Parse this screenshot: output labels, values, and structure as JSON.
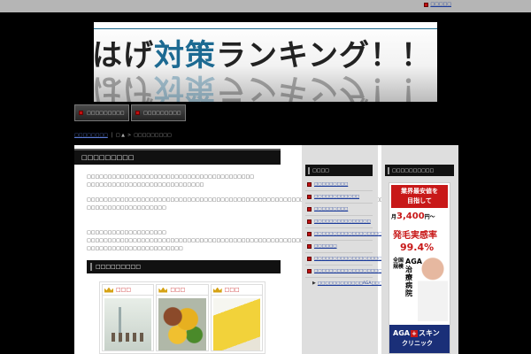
{
  "topbar": {
    "link": "□□□□□"
  },
  "banner": {
    "text_1": "はげ",
    "text_2": "対策",
    "text_3": "ランキング！！"
  },
  "nav": [
    {
      "label": "□□□□□□□□□"
    },
    {
      "label": "□□□□□□□□□"
    }
  ],
  "breadcrumb": {
    "home": "□□□□□□□□",
    "separator_1": "│",
    "extra": "□ ▲",
    "separator_2": ">",
    "current": "□□□□□□□□□"
  },
  "main": {
    "title": "□□□□□□□□□",
    "paragraphs": [
      "□□□□□□□□□□□□□□□□□□□□□□□□□□□□□□□□□□□□□□□□ □□□□□□□□□□□□□□□□□□□□□□□□□□□□",
      "□□□□□□□□□□□□□□□□□□□□□□□□□□□□□□□□□□□□□□□□□□□□□□□□□□□□□□□□□□□□□□□□□□□□□□□□□ □□□□□□□□□□□□□□□□□□□",
      "□□□□□□□□□□□□□□□□□□□",
      "□□□□□□□□□□□□□□□□□□□□□□□□□□□□□□□□□□□□□□□□□□□□□□□□□□□□□□□□□ □□□□□□□□□□□□□□□□□□□□□□□"
    ],
    "ranking_heading": "□□□□□□□□□",
    "ranks": [
      {
        "label": "□□□"
      },
      {
        "label": "□□□"
      },
      {
        "label": "□□□"
      }
    ]
  },
  "sidebar_1": {
    "heading": "□□□□",
    "items": [
      "□□□□□□□□□",
      "□□□□□□□□□□□□",
      "□□□□□□□□□",
      "□□□□□□□□□□□□□□□",
      "□□□□□□□□□□□□□□□□□□□□□□□□□□□",
      "□□□□□□",
      "□□□□□□□□□□□□□□□□□□□□□□□",
      "□□□□□□□□□□□□□□□□□□□□□□"
    ],
    "sub_items": [
      {
        "arrow": "▶",
        "text": "□□□□□□□□□□□□AGA□□□□□□□□□□□□"
      }
    ]
  },
  "sidebar_2": {
    "heading": "□□□□□□□□□□",
    "ad": {
      "top_line_1": "業界最安値を",
      "top_line_2": "目指して",
      "price_prefix": "月",
      "price": "3,400",
      "price_suffix": "円〜",
      "line": "発毛実感率",
      "percent": "99.4%",
      "nation": "全国規模",
      "vertical": "AGA治療病院",
      "brand_1": "AGA",
      "brand_plus": "+",
      "brand_2": "スキン",
      "clinic": "クリニック"
    }
  },
  "colors": {
    "page_bg": "#000000",
    "topbar_bg": "#b5b5b5",
    "link_blue": "#1a3a9a",
    "banner_blue": "#1d6a92",
    "ad_red": "#c81818",
    "ad_navy": "#1a2f78"
  }
}
